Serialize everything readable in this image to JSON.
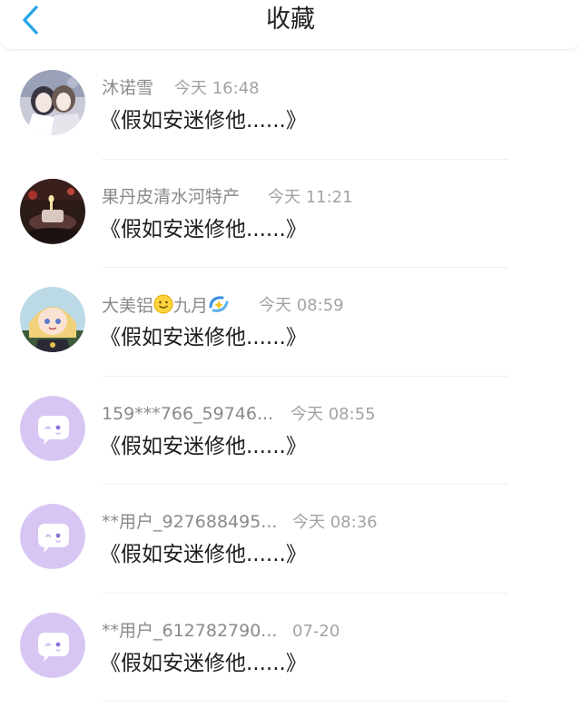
{
  "header": {
    "title": "收藏",
    "back_icon": "chevron-left-icon",
    "accent_color": "#2aa7e8"
  },
  "items": [
    {
      "name": "沐诺雪",
      "time": "今天 16:48",
      "snippet": "《假如安迷修他......》",
      "avatar": "photo-avatar"
    },
    {
      "name": "果丹皮清水河特产",
      "time": "今天 11:21",
      "snippet": "《假如安迷修他......》",
      "avatar": "photo-avatar"
    },
    {
      "name_before_emoji": "大美铝",
      "name_after_emoji": "九月",
      "time": "今天 08:59",
      "snippet": "《假如安迷修他......》",
      "avatar": "photo-avatar",
      "name_icons": [
        "smiley-emoji-icon",
        "sparkle-emoji-icon"
      ]
    },
    {
      "name": "159***766_59746...",
      "time": "今天 08:55",
      "snippet": "《假如安迷修他......》",
      "avatar": "default-chat-avatar"
    },
    {
      "name": "**用户_927688495...",
      "time": "今天 08:36",
      "snippet": "《假如安迷修他......》",
      "avatar": "default-chat-avatar"
    },
    {
      "name": "**用户_612782790...",
      "time": "07-20",
      "snippet": "《假如安迷修他......》",
      "avatar": "default-chat-avatar"
    }
  ],
  "colors": {
    "default_avatar_bg": "#d7c6f4",
    "name_text": "#8a8a8a",
    "time_text": "#a3a3a3",
    "snippet_text": "#1e1e1e"
  }
}
